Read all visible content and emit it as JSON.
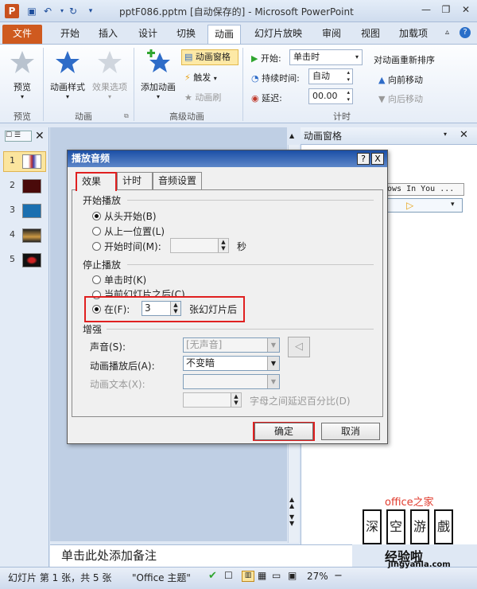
{
  "window": {
    "title": "pptF086.pptm [自动保存的] - Microsoft PowerPoint",
    "app_icon": "P",
    "quick_access": [
      "save-icon",
      "undo-icon",
      "redo-icon",
      "customize-icon"
    ]
  },
  "tabs": [
    "文件",
    "开始",
    "插入",
    "设计",
    "切换",
    "动画",
    "幻灯片放映",
    "审阅",
    "视图",
    "加载项"
  ],
  "active_tab": "动画",
  "ribbon": {
    "preview_label": "预览",
    "preview_group": "预览",
    "anim_style": "动画样式",
    "effect_options": "效果选项",
    "animation_group": "动画",
    "add_animation": "添加动画",
    "anim_pane_btn": "动画窗格",
    "trigger": "触发",
    "anim_painter": "动画刷",
    "advanced_group": "高级动画",
    "start_label": "开始:",
    "start_value": "单击时",
    "duration_label": "持续时间:",
    "duration_value": "自动",
    "delay_label": "延迟:",
    "delay_value": "00.00",
    "timing_group": "计时",
    "reorder_label": "对动画重新排序",
    "move_earlier": "向前移动",
    "move_later": "向后移动"
  },
  "slides": [
    "1",
    "2",
    "3",
    "4",
    "5"
  ],
  "anim_pane": {
    "title": "动画窗格",
    "item_text": "ows In You ..."
  },
  "notes_placeholder": "单击此处添加备注",
  "status": {
    "slide_info": "幻灯片 第 1 张，共 5 张",
    "theme": "\"Office 主题\"",
    "zoom": "27%"
  },
  "dialog": {
    "title": "播放音频",
    "help": "?",
    "close": "X",
    "tabs": [
      "效果",
      "计时",
      "音频设置"
    ],
    "start_section": "开始播放",
    "start_opts": [
      "从头开始(B)",
      "从上一位置(L)",
      "开始时间(M):"
    ],
    "seconds": "秒",
    "stop_section": "停止播放",
    "stop_opts": [
      "单击时(K)",
      "当前幻灯片之后(C)",
      "在(F):"
    ],
    "stop_after_value": "3",
    "stop_after_suffix": "张幻灯片后",
    "enhance_section": "增强",
    "sound_label": "声音(S):",
    "sound_value": "[无声音]",
    "after_anim_label": "动画播放后(A):",
    "after_anim_value": "不变暗",
    "anim_text_label": "动画文本(X):",
    "letter_delay_label": "字母之间延迟百分比(D)",
    "ok": "确定",
    "cancel": "取消"
  },
  "watermark": {
    "chars": [
      "深",
      "空",
      "游",
      "戲"
    ],
    "line2": "经验啦",
    "url": "jingyanla.com",
    "office_text": "office之家"
  }
}
